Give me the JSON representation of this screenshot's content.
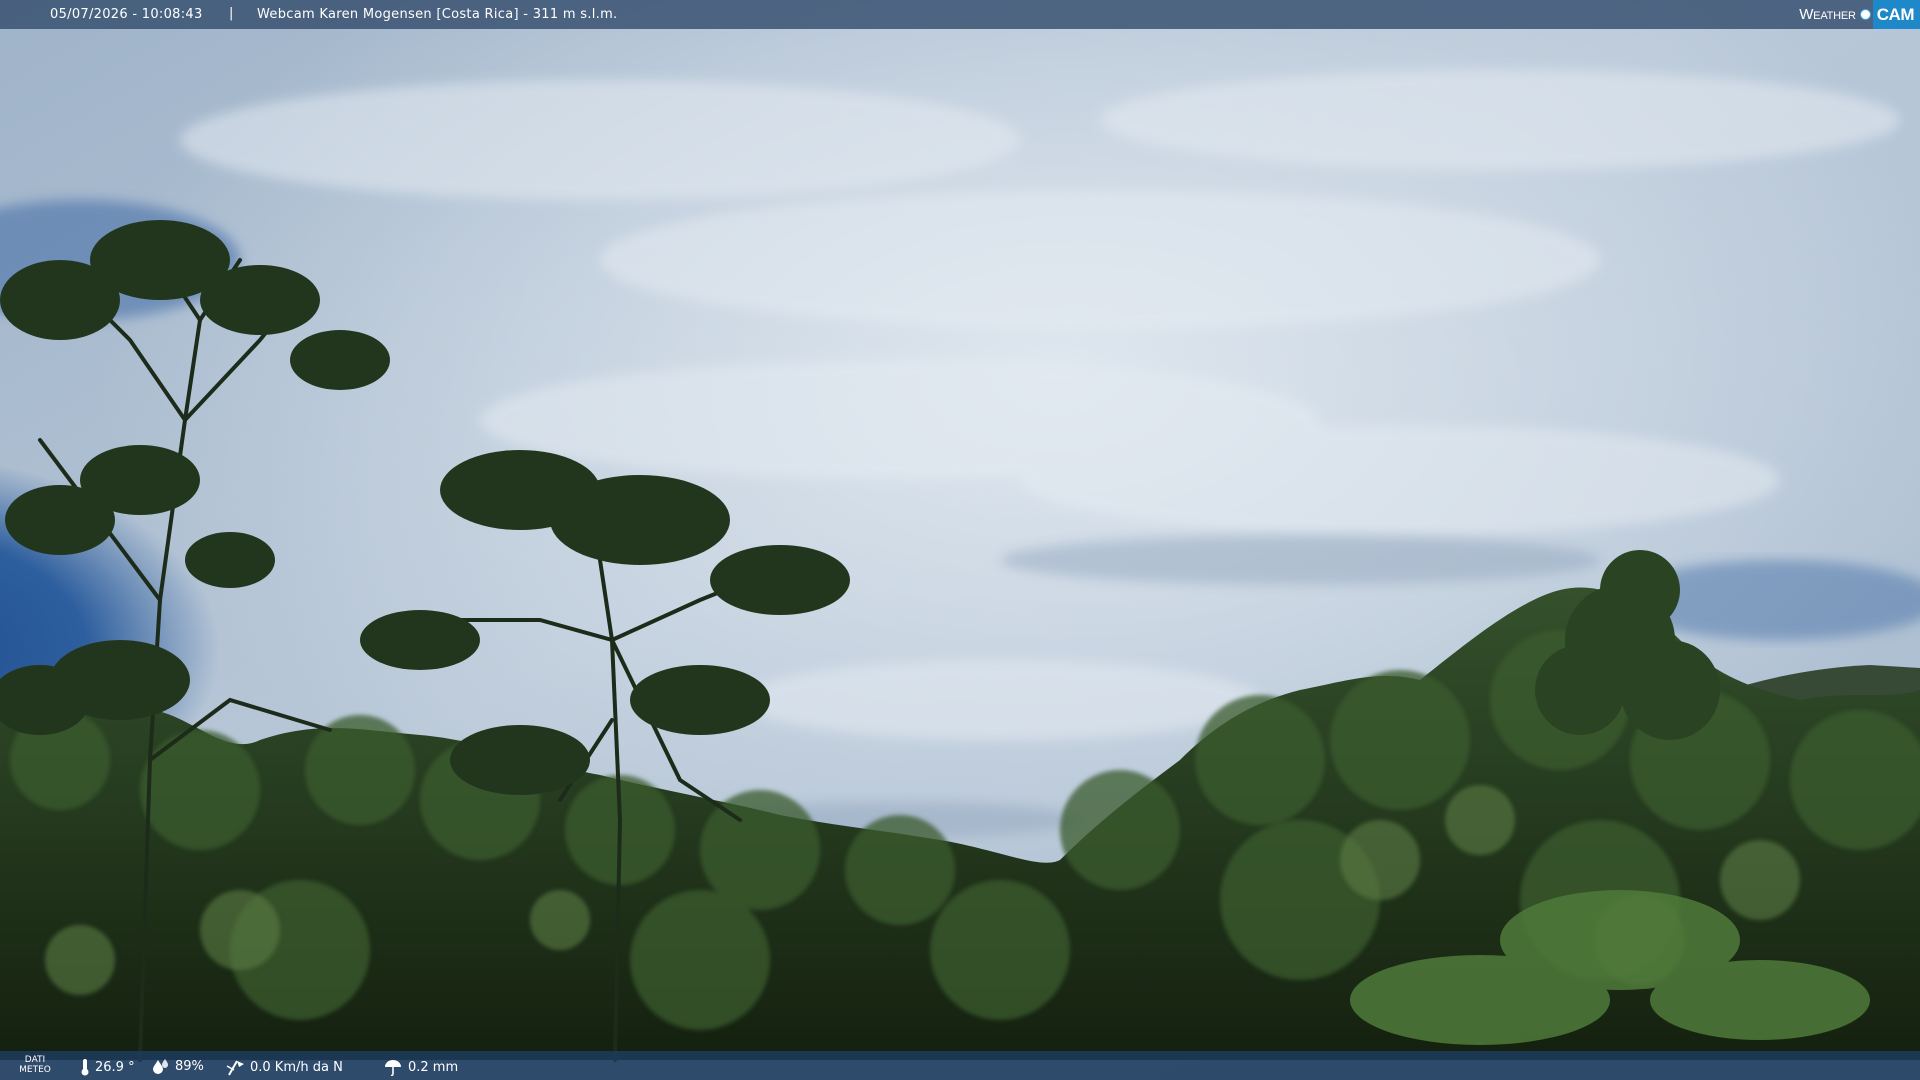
{
  "header": {
    "timestamp": "05/07/2026 - 10:08:43",
    "separator": "|",
    "title": "Webcam Karen Mogensen [Costa Rica] - 311 m s.l.m."
  },
  "logo": {
    "weather": "Weather",
    "cam": "CAM"
  },
  "footer": {
    "label_line1": "DATI",
    "label_line2": "METEO",
    "temperature": "26.9 °",
    "humidity": "89%",
    "wind": "0.0 Km/h da N",
    "rain": "0.2 mm"
  },
  "icons": {
    "temperature": "thermometer-icon",
    "humidity": "humidity-drops-icon",
    "wind": "wind-vane-icon",
    "rain": "rain-umbrella-icon"
  },
  "colors": {
    "sky_top": "#8fa6c0",
    "sky_blue": "#2f5c97",
    "cloud": "#c9d6e4",
    "forest_dark": "#1a2a18",
    "forest_mid": "#2f4a26",
    "logo_accent": "#1e88c9"
  }
}
